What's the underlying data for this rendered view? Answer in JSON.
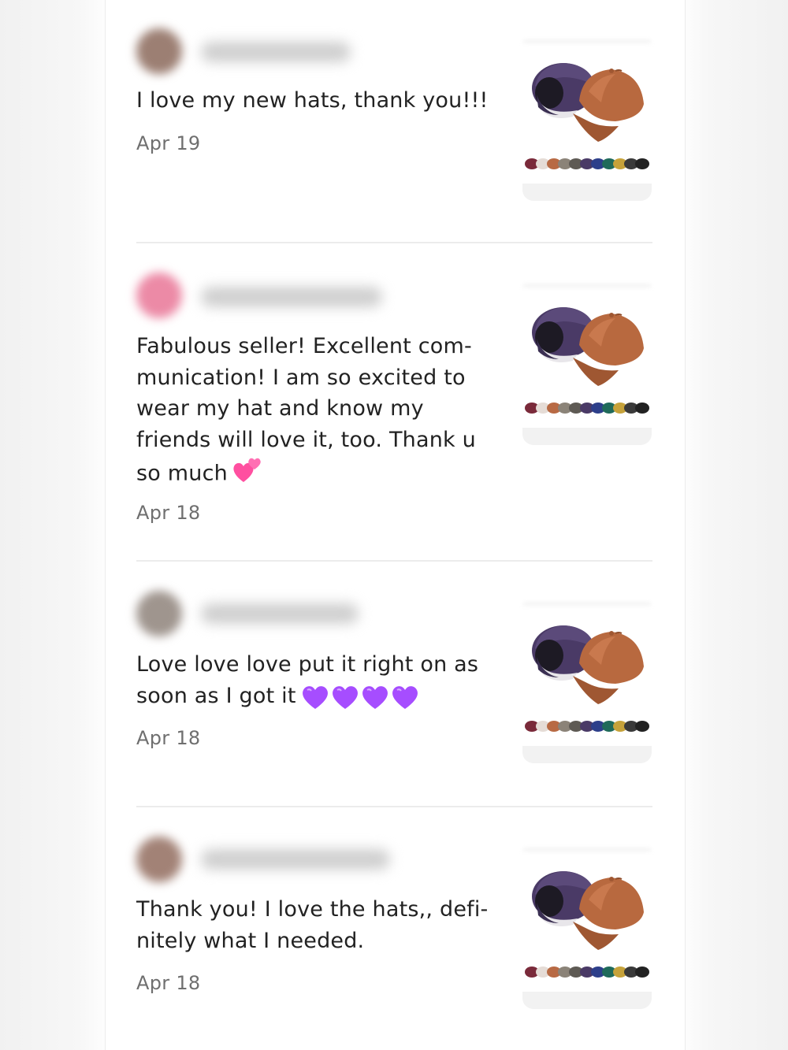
{
  "reviews": [
    {
      "avatar_color": "#9c7f73",
      "text": "I love my new hats, thank you!!!",
      "emoji": "",
      "date": "Apr 19",
      "thumbnail": "baseball-caps-product-photo"
    },
    {
      "avatar_color": "#ec8aa6",
      "text": "Fabulous seller! Excellent com-\nmunication! I am so excited to\nwear my hat and know my\nfriends will love it, too. Thank u\nso much",
      "emoji": "two-hearts",
      "date": "Apr 18",
      "thumbnail": "baseball-caps-product-photo"
    },
    {
      "avatar_color": "#9f958e",
      "text": "Love love love put it right on as\nsoon as I got it",
      "emoji": "purple-hearts-x4",
      "date": "Apr 18",
      "thumbnail": "baseball-caps-product-photo"
    },
    {
      "avatar_color": "#a28276",
      "text": "Thank you! I love the hats,, defi-\nnitely what I needed.",
      "emoji": "",
      "date": "Apr 18",
      "thumbnail": "baseball-caps-product-photo"
    }
  ],
  "colors": {
    "cap_purple": "#4a3a66",
    "cap_orange": "#b8693f",
    "divider": "#ececec",
    "date_gray": "#6f6f6f"
  }
}
